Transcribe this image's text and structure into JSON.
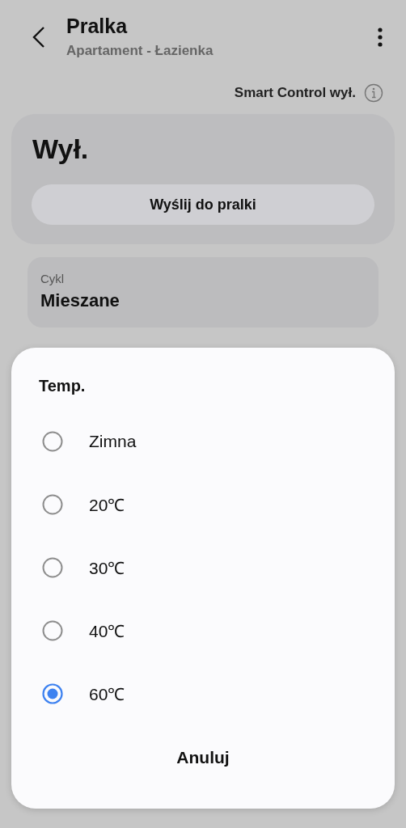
{
  "header": {
    "title": "Pralka",
    "subtitle": "Apartament - Łazienka"
  },
  "smart_control": {
    "label": "Smart Control wył."
  },
  "status_card": {
    "state": "Wył.",
    "button": "Wyślij do pralki"
  },
  "cycle": {
    "label": "Cykl",
    "value": "Mieszane"
  },
  "dialog": {
    "title": "Temp.",
    "options": [
      {
        "label": "Zimna",
        "selected": false
      },
      {
        "label": "20℃",
        "selected": false
      },
      {
        "label": "30℃",
        "selected": false
      },
      {
        "label": "40℃",
        "selected": false
      },
      {
        "label": "60℃",
        "selected": true
      }
    ],
    "cancel": "Anuluj"
  }
}
